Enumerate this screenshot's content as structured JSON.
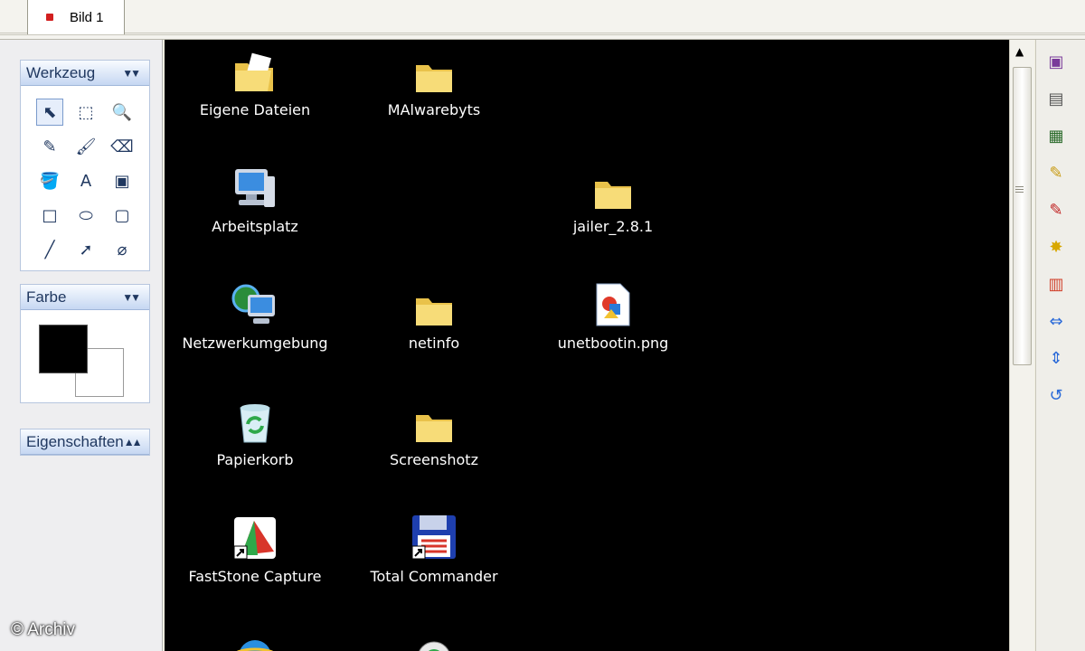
{
  "tabs": [
    {
      "label": "Bild 1"
    }
  ],
  "sidebar": {
    "tools_panel": {
      "title": "Werkzeug",
      "tools": [
        {
          "name": "select-tool-icon",
          "glyph": "⬉"
        },
        {
          "name": "rect-select-tool-icon",
          "glyph": "⬚"
        },
        {
          "name": "zoom-tool-icon",
          "glyph": "🔍"
        },
        {
          "name": "pencil-tool-icon",
          "glyph": "✎"
        },
        {
          "name": "brush-tool-icon",
          "glyph": "🖌"
        },
        {
          "name": "eraser-tool-icon",
          "glyph": "⌫"
        },
        {
          "name": "fill-tool-icon",
          "glyph": "🪣"
        },
        {
          "name": "text-tool-icon",
          "glyph": "A"
        },
        {
          "name": "image-tool-icon",
          "glyph": "▣"
        },
        {
          "name": "rectangle-tool-icon",
          "glyph": "□"
        },
        {
          "name": "ellipse-tool-icon",
          "glyph": "⬭"
        },
        {
          "name": "rounded-rect-tool-icon",
          "glyph": "▢"
        },
        {
          "name": "line-tool-icon",
          "glyph": "╱"
        },
        {
          "name": "arrow-tool-icon",
          "glyph": "➚"
        },
        {
          "name": "color-picker-tool-icon",
          "glyph": "⌀"
        }
      ]
    },
    "color_panel": {
      "title": "Farbe",
      "foreground": "#000000",
      "background": "#ffffff"
    },
    "properties_panel": {
      "title": "Eigenschaften"
    }
  },
  "desktop_icons": [
    {
      "label": "Eigene Dateien",
      "icon": "folder-documents-icon"
    },
    {
      "label": "MAlwarebyts",
      "icon": "folder-icon"
    },
    {
      "label": "Arbeitsplatz",
      "icon": "my-computer-icon"
    },
    {
      "label": "jailer_2.8.1",
      "icon": "folder-icon"
    },
    {
      "label": "Netzwerkumgebung",
      "icon": "network-icon"
    },
    {
      "label": "netinfo",
      "icon": "folder-icon"
    },
    {
      "label": "unetbootin.png",
      "icon": "png-file-icon"
    },
    {
      "label": "Papierkorb",
      "icon": "recycle-bin-icon"
    },
    {
      "label": "Screenshotz",
      "icon": "folder-icon"
    },
    {
      "label": "FastStone Capture",
      "icon": "faststone-shortcut-icon"
    },
    {
      "label": "Total Commander",
      "icon": "total-commander-shortcut-icon"
    },
    {
      "label": "",
      "icon": "internet-explorer-icon"
    },
    {
      "label": "",
      "icon": "media-player-icon"
    }
  ],
  "right_toolbar": [
    "frame-icon",
    "image-icon",
    "grid-icon",
    "pen-check-icon",
    "pen-mark-icon",
    "brightness-icon",
    "gradient-icon",
    "flip-horizontal-icon",
    "flip-vertical-icon",
    "rotate-icon"
  ],
  "watermark": "© Archiv",
  "colors": {
    "canvas": "#000000",
    "panel_header": "#c6d7f2",
    "folder": "#f5d565"
  }
}
